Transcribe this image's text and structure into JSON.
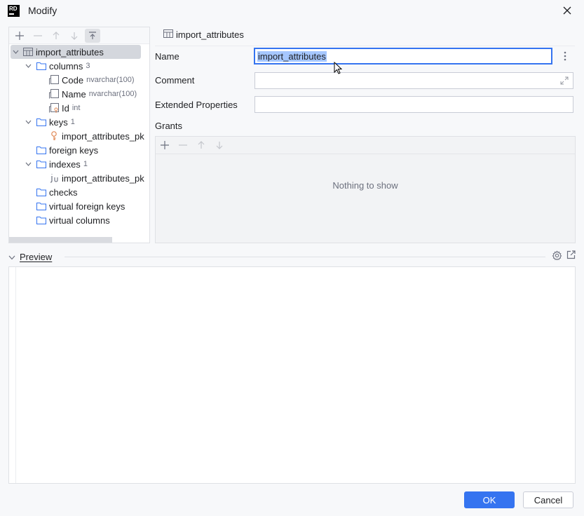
{
  "window": {
    "title": "Modify",
    "logo_text": "RD"
  },
  "tree": {
    "root": {
      "label": "import_attributes"
    },
    "columns": {
      "label": "columns",
      "count": "3",
      "items": [
        {
          "label": "Code",
          "type": "nvarchar(100)"
        },
        {
          "label": "Name",
          "type": "nvarchar(100)"
        },
        {
          "label": "Id",
          "type": "int"
        }
      ]
    },
    "keys": {
      "label": "keys",
      "count": "1",
      "item": "import_attributes_pk"
    },
    "foreign_keys": {
      "label": "foreign keys"
    },
    "indexes": {
      "label": "indexes",
      "count": "1",
      "item": "import_attributes_pk"
    },
    "checks": {
      "label": "checks"
    },
    "virtual_foreign_keys": {
      "label": "virtual foreign keys"
    },
    "virtual_columns": {
      "label": "virtual columns"
    }
  },
  "form": {
    "header": "import_attributes",
    "name_label": "Name",
    "name_value": "import_attributes",
    "comment_label": "Comment",
    "comment_value": "",
    "ext_props_label": "Extended Properties",
    "ext_props_value": "",
    "grants_label": "Grants",
    "grants_empty": "Nothing to show"
  },
  "preview": {
    "label": "Preview",
    "content": ""
  },
  "buttons": {
    "ok": "OK",
    "cancel": "Cancel"
  },
  "colors": {
    "accent": "#3574f0",
    "selection": "#a6c7ff",
    "folder": "#3574f0",
    "key": "#e08855"
  }
}
